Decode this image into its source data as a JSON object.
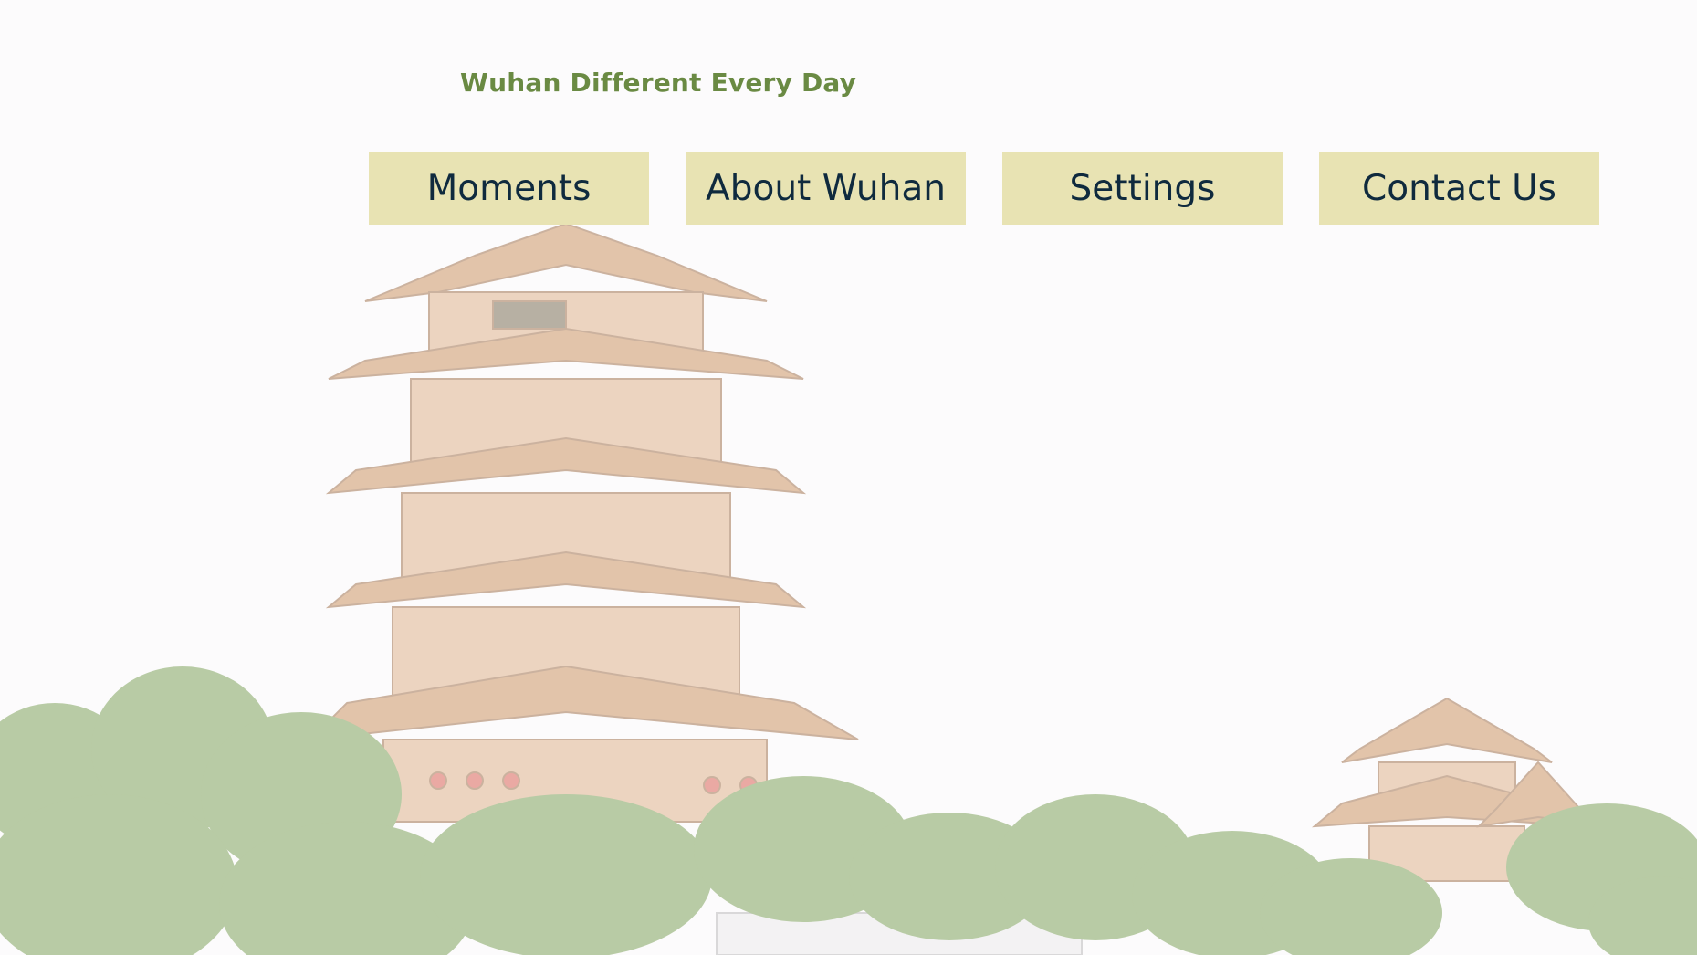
{
  "header": {
    "title": "Wuhan Different Every Day"
  },
  "nav": {
    "items": [
      {
        "label": "Moments"
      },
      {
        "label": "About Wuhan"
      },
      {
        "label": "Settings"
      },
      {
        "label": "Contact Us"
      }
    ]
  },
  "colors": {
    "title": "#6a8a43",
    "nav_background": "#e8e3b3",
    "nav_text": "#0f2a3e",
    "page_background": "#fcfbfc"
  },
  "background_image": {
    "subject": "yellow-crane-tower-pagoda-with-trees"
  }
}
